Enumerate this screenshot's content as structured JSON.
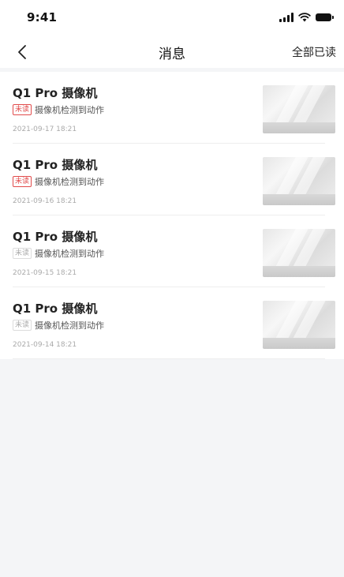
{
  "status_bar": {
    "time": "9:41",
    "icons": [
      "signal-icon",
      "wifi-icon",
      "battery-icon"
    ]
  },
  "nav": {
    "back_icon": "chevron-left-icon",
    "title": "消息",
    "mark_all_read": "全部已读"
  },
  "colors": {
    "unread_tag": "#e14b4b",
    "read_tag": "#aaaaaa",
    "background": "#f4f5f7"
  },
  "messages": [
    {
      "title": "Q1 Pro 摄像机",
      "tag": "未读",
      "unread": true,
      "desc": "摄像机检测到动作",
      "date": "2021-09-17 18:21"
    },
    {
      "title": "Q1 Pro 摄像机",
      "tag": "未读",
      "unread": true,
      "desc": "摄像机检测到动作",
      "date": "2021-09-16 18:21"
    },
    {
      "title": "Q1 Pro 摄像机",
      "tag": "未读",
      "unread": false,
      "desc": "摄像机检测到动作",
      "date": "2021-09-15 18:21"
    },
    {
      "title": "Q1 Pro 摄像机",
      "tag": "未读",
      "unread": false,
      "desc": "摄像机检测到动作",
      "date": "2021-09-14 18:21"
    }
  ]
}
